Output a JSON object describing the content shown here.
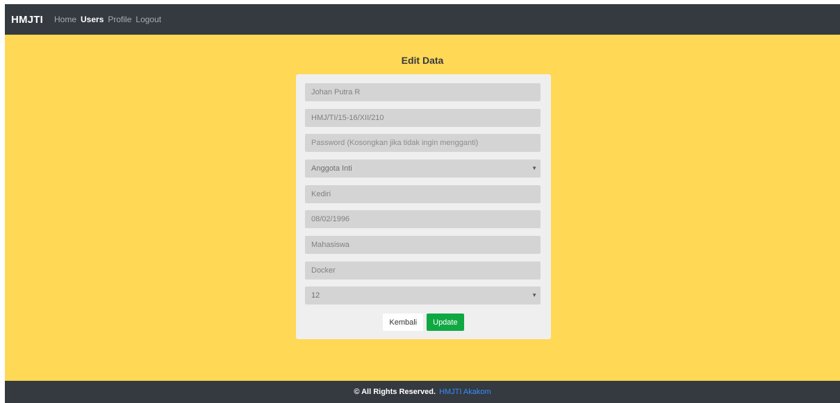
{
  "navbar": {
    "brand": "HMJTI",
    "links": [
      "Home",
      "Users",
      "Profile",
      "Logout"
    ]
  },
  "page": {
    "title": "Edit Data"
  },
  "form": {
    "name": "Johan Putra R",
    "member_id": "HMJ/TI/15-16/XII/210",
    "password_placeholder": "Password (Kosongkan jika tidak ingin mengganti)",
    "role": "Anggota Inti",
    "birthplace": "Kediri",
    "birthdate": "08/02/1996",
    "status": "Mahasiswa",
    "skill": "Docker",
    "number": "12",
    "back_label": "Kembali",
    "update_label": "Update"
  },
  "footer": {
    "rights": "© All Rights Reserved.",
    "link": "HMJTI Akakom"
  },
  "colors": {
    "background": "#ffd855",
    "navbar": "#343a40",
    "update_button": "#10a843",
    "footer_link": "#3a8bff"
  }
}
